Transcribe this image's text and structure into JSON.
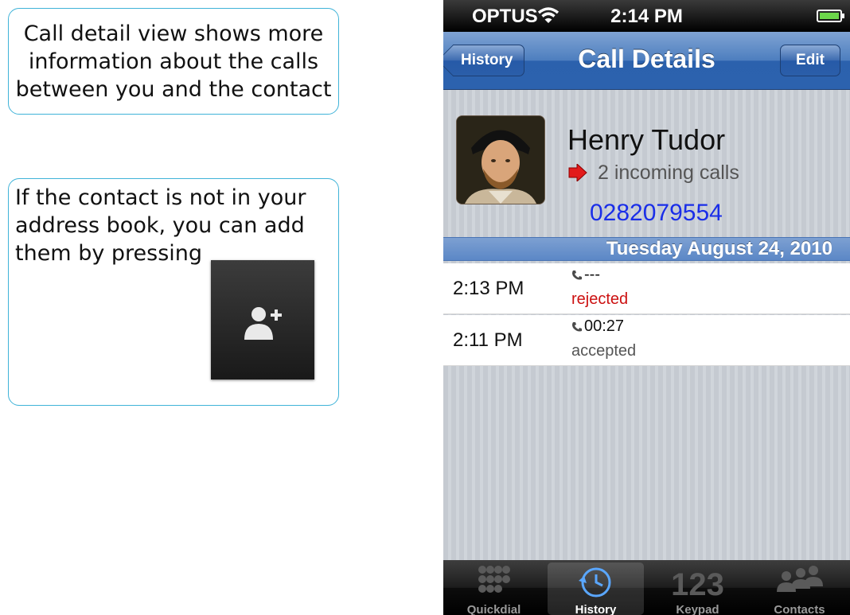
{
  "callouts": {
    "detail_text": "Call detail view shows more information about the calls between you and the contact",
    "add_text": " If the contact is not in your address book, you can add them by pressing"
  },
  "status_bar": {
    "carrier": "OPTUS",
    "time": "2:14 PM",
    "battery": "charging"
  },
  "nav": {
    "back_label": "History",
    "title": "Call Details",
    "edit_label": "Edit"
  },
  "contact": {
    "name": "Henry Tudor",
    "call_summary": "2 incoming calls",
    "phone": "0282079554"
  },
  "call_log": {
    "date": "Tuesday August 24, 2010",
    "rows": [
      {
        "time": "2:13 PM",
        "duration": "---",
        "status": "rejected",
        "status_color": "#cc1111"
      },
      {
        "time": "2:11 PM",
        "duration": "00:27",
        "status": "accepted",
        "status_color": "#555555"
      }
    ]
  },
  "tabs": [
    {
      "label": "Quickdial",
      "icon": "grid-icon"
    },
    {
      "label": "History",
      "icon": "history-clock-icon",
      "active": true
    },
    {
      "label": "Keypad",
      "icon": "keypad-123-icon",
      "glyph": "123"
    },
    {
      "label": "Contacts",
      "icon": "contacts-icon"
    }
  ],
  "colors": {
    "nav_blue": "#2c62ae",
    "callout_border": "#3fb3d8",
    "phone_number": "#1a2ee8",
    "rejected": "#cc1111"
  }
}
